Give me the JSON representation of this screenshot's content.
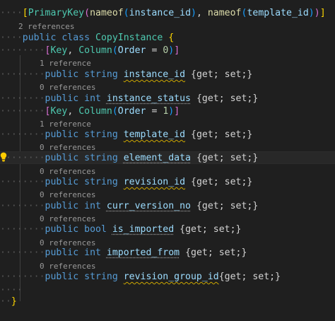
{
  "code": {
    "attribute_primary_key": {
      "open_bracket": "[",
      "name": "PrimaryKey",
      "paren_open": "(",
      "arg1_fn": "nameof",
      "arg1_paren_open": "(",
      "arg1_id": "instance_id",
      "arg1_paren_close": ")",
      "comma": ", ",
      "arg2_fn": "nameof",
      "arg2_paren_open": "(",
      "arg2_id": "template_id",
      "arg2_paren_close": ")",
      "paren_close": ")",
      "close_bracket": "]"
    },
    "class_refs": "2 references",
    "class_decl": {
      "kw_public": "public",
      "kw_class": "class",
      "name": "CopyInstance",
      "brace": "{"
    },
    "attr_order0": {
      "open": "[",
      "key": "Key",
      "comma": ", ",
      "column": "Column",
      "paren_open": "(",
      "order": "Order",
      "eq": " = ",
      "value": "0",
      "paren_close": ")",
      "close": "]"
    },
    "attr_order1": {
      "open": "[",
      "key": "Key",
      "comma": ", ",
      "column": "Column",
      "paren_open": "(",
      "order": "Order",
      "eq": " = ",
      "value": "1",
      "paren_close": ")",
      "close": "]"
    },
    "properties": [
      {
        "refs": "1 reference",
        "modifier": "public",
        "type": "string",
        "name": "instance_id",
        "accessors": " {get; set;}"
      },
      {
        "refs": "0 references",
        "modifier": "public",
        "type": "int",
        "name": "instance_status",
        "accessors": " {get; set;}"
      },
      {
        "refs": "1 reference",
        "modifier": "public",
        "type": "string",
        "name": "template_id",
        "accessors": " {get; set;}"
      },
      {
        "refs": "0 references",
        "modifier": "public",
        "type": "string",
        "name": "element_data",
        "accessors": " {get; set;}"
      },
      {
        "refs": "0 references",
        "modifier": "public",
        "type": "string",
        "name": "revision_id",
        "accessors": " {get; set;}"
      },
      {
        "refs": "0 references",
        "modifier": "public",
        "type": "int",
        "name": "curr_version_no",
        "accessors": " {get; set;}"
      },
      {
        "refs": "0 references",
        "modifier": "public",
        "type": "bool",
        "name": "is_imported",
        "accessors": " {get; set;}"
      },
      {
        "refs": "0 references",
        "modifier": "public",
        "type": "int",
        "name": "imported_from",
        "accessors": " {get; set;}"
      },
      {
        "refs": "0 references",
        "modifier": "public",
        "type": "string",
        "name": "revision_group_id",
        "accessors": "{get; set;}"
      }
    ],
    "class_close": "}"
  },
  "icons": {
    "lightbulb": "lightbulb-icon"
  },
  "colors": {
    "background": "#1f1f1f",
    "keyword": "#569cd6",
    "type": "#4ec9b0",
    "function": "#dcdcaa",
    "identifier": "#9cdcfe",
    "number": "#b5cea8",
    "codelens": "#999999",
    "warning_squiggle": "#cca700",
    "bracket_level1": "#ffd700",
    "bracket_level2": "#da70d6",
    "bracket_level3": "#179fff"
  }
}
